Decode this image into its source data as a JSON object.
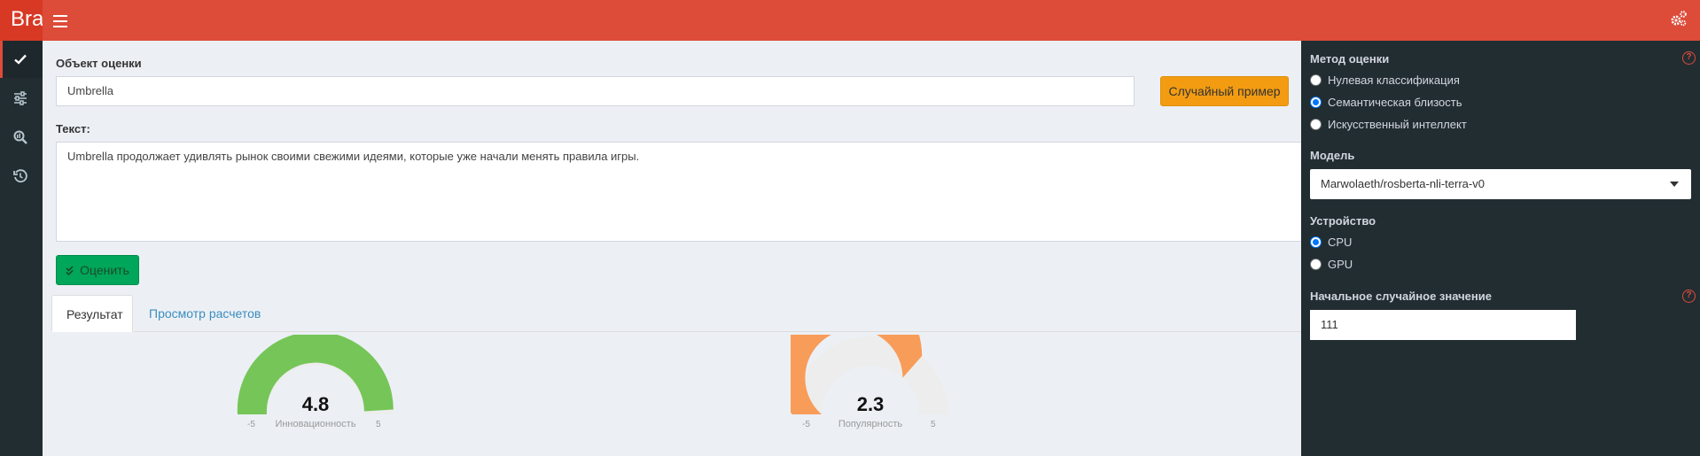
{
  "header": {
    "logo_text": "Brand Analyzer",
    "menu_icon": "hamburger-icon",
    "settings_icon": "gears-icon",
    "accent_color": "#dd4b39"
  },
  "sidebar": {
    "items": [
      {
        "icon": "check-icon",
        "active": true
      },
      {
        "icon": "sliders-icon",
        "active": false
      },
      {
        "icon": "search-chart-icon",
        "active": false
      },
      {
        "icon": "history-icon",
        "active": false
      }
    ]
  },
  "main": {
    "object_label": "Объект оценки",
    "object_value": "Umbrella",
    "random_button": "Случайный пример",
    "text_label": "Текст:",
    "text_value": "Umbrella продолжает удивлять рынок своими свежими идеями, которые уже начали менять правила игры.",
    "evaluate_button": "Оценить",
    "tabs": [
      {
        "label": "Результат",
        "active": true
      },
      {
        "label": "Просмотр расчетов",
        "active": false
      }
    ],
    "gauges": [
      {
        "value": "4.8",
        "min": "-5",
        "max": "5",
        "label": "Инновационность",
        "fraction": 0.98,
        "color": "#76c558"
      },
      {
        "value": "2.3",
        "min": "-5",
        "max": "5",
        "label": "Популярность",
        "fraction": 0.73,
        "color": "#f89c59"
      }
    ]
  },
  "right_sidebar": {
    "method_label": "Метод оценки",
    "methods": [
      {
        "label": "Нулевая классификация",
        "selected": false
      },
      {
        "label": "Семантическая близость",
        "selected": true
      },
      {
        "label": "Искусственный интеллект",
        "selected": false
      }
    ],
    "model_label": "Модель",
    "model_value": "Marwolaeth/rosberta-nli-terra-v0",
    "device_label": "Устройство",
    "devices": [
      {
        "label": "CPU",
        "selected": true
      },
      {
        "label": "GPU",
        "selected": false
      }
    ],
    "seed_label": "Начальное случайное значение",
    "seed_value": "111",
    "help_icon": "question-circle-icon"
  }
}
